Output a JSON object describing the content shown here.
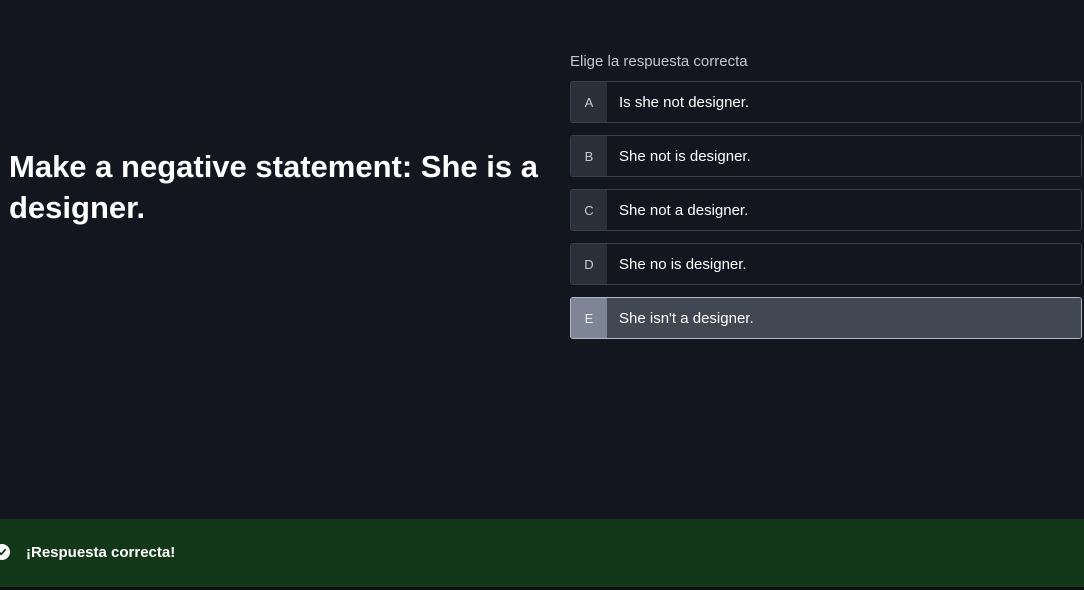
{
  "question": {
    "text": "Make a negative statement: She is a designer."
  },
  "answers": {
    "prompt": "Elige la respuesta correcta",
    "options": [
      {
        "letter": "A",
        "text": "Is she not designer."
      },
      {
        "letter": "B",
        "text": "She not is designer."
      },
      {
        "letter": "C",
        "text": "She not a designer."
      },
      {
        "letter": "D",
        "text": "She no is designer."
      },
      {
        "letter": "E",
        "text": "She isn't a designer."
      }
    ],
    "selected": "E"
  },
  "feedback": {
    "message": "¡Respuesta correcta!",
    "icon": "check-circle-icon"
  },
  "colors": {
    "background": "#13161f",
    "feedback_bar": "#133719",
    "selected_option": "#414753"
  }
}
